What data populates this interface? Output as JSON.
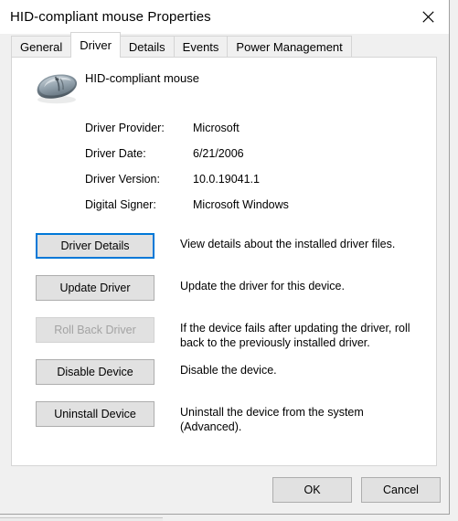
{
  "window": {
    "title": "HID-compliant mouse Properties",
    "close_icon": "close-icon"
  },
  "tabs": [
    {
      "label": "General",
      "selected": false
    },
    {
      "label": "Driver",
      "selected": true
    },
    {
      "label": "Details",
      "selected": false
    },
    {
      "label": "Events",
      "selected": false
    },
    {
      "label": "Power Management",
      "selected": false
    }
  ],
  "device": {
    "icon": "mouse-icon",
    "name": "HID-compliant mouse"
  },
  "driver_info": [
    {
      "label": "Driver Provider:",
      "value": "Microsoft"
    },
    {
      "label": "Driver Date:",
      "value": "6/21/2006"
    },
    {
      "label": "Driver Version:",
      "value": "10.0.19041.1"
    },
    {
      "label": "Digital Signer:",
      "value": "Microsoft Windows"
    }
  ],
  "actions": [
    {
      "button": "Driver Details",
      "description": "View details about the installed driver files.",
      "disabled": false,
      "focused": true
    },
    {
      "button": "Update Driver",
      "description": "Update the driver for this device.",
      "disabled": false,
      "focused": false
    },
    {
      "button": "Roll Back Driver",
      "description": "If the device fails after updating the driver, roll back to the previously installed driver.",
      "disabled": true,
      "focused": false
    },
    {
      "button": "Disable Device",
      "description": "Disable the device.",
      "disabled": false,
      "focused": false
    },
    {
      "button": "Uninstall Device",
      "description": "Uninstall the device from the system (Advanced).",
      "disabled": false,
      "focused": false
    }
  ],
  "footer": {
    "ok_label": "OK",
    "cancel_label": "Cancel"
  },
  "colors": {
    "accent": "#0078d7",
    "button_face": "#e1e1e1",
    "button_border": "#adadad",
    "dialog_bg": "#f0f0f0",
    "panel_bg": "#ffffff",
    "disabled_text": "#a3a3a3"
  }
}
